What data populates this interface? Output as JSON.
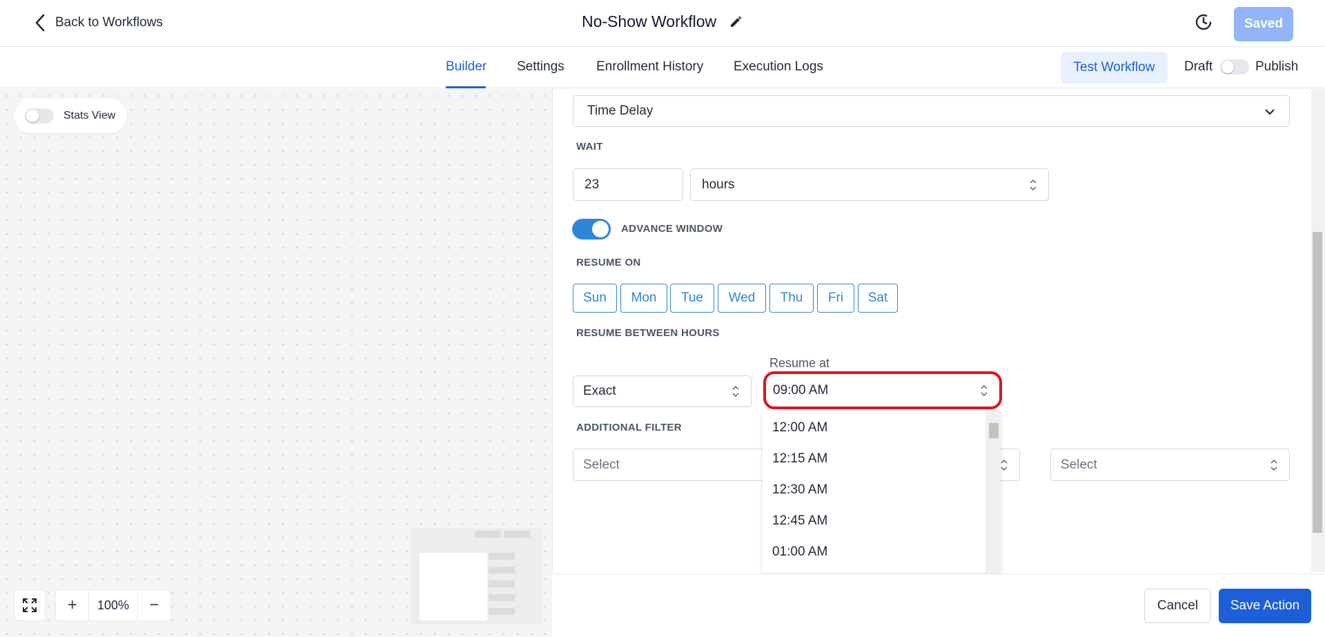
{
  "header": {
    "back_label": "Back to Workflows",
    "title": "No-Show Workflow",
    "saved_label": "Saved"
  },
  "tabs": [
    {
      "label": "Builder",
      "active": true
    },
    {
      "label": "Settings",
      "active": false
    },
    {
      "label": "Enrollment History",
      "active": false
    },
    {
      "label": "Execution Logs",
      "active": false
    }
  ],
  "toolbar": {
    "test_label": "Test Workflow",
    "draft_label": "Draft",
    "publish_label": "Publish"
  },
  "canvas": {
    "stats_label": "Stats View",
    "zoom_value": "100%",
    "zoom_in": "+",
    "zoom_out": "−"
  },
  "action": {
    "type_value": "Time Delay",
    "wait_label": "WAIT",
    "wait_amount": "23",
    "wait_unit": "hours",
    "advance_window_label": "ADVANCE WINDOW",
    "advance_window_on": true,
    "resume_on_label": "RESUME ON",
    "days": [
      "Sun",
      "Mon",
      "Tue",
      "Wed",
      "Thu",
      "Fri",
      "Sat"
    ],
    "resume_between_label": "RESUME BETWEEN HOURS",
    "resume_mode": "Exact",
    "resume_at_label": "Resume at",
    "resume_at_value": "09:00 AM",
    "time_options": [
      "12:00 AM",
      "12:15 AM",
      "12:30 AM",
      "12:45 AM",
      "01:00 AM"
    ],
    "additional_filter_label": "ADDITIONAL FILTER",
    "filter_placeholder_1": "Select",
    "filter_placeholder_2": "Select"
  },
  "footer": {
    "cancel_label": "Cancel",
    "save_label": "Save Action"
  },
  "colors": {
    "accent": "#1d5fd8",
    "day_outline": "#2f86d6",
    "highlight": "#e0141e"
  }
}
